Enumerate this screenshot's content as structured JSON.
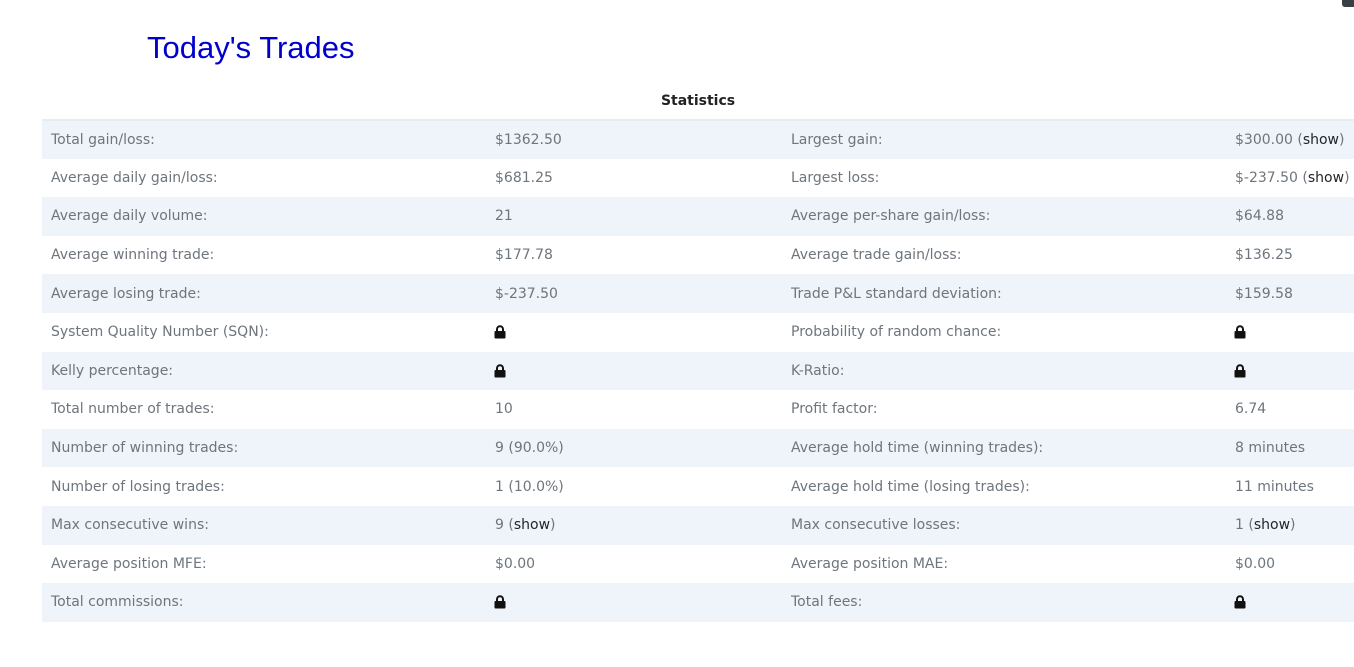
{
  "page": {
    "title": "Today's Trades"
  },
  "stats": {
    "heading": "Statistics",
    "rows": [
      {
        "left_label": "Total gain/loss:",
        "left_value": "$1362.50",
        "right_label": "Largest gain:",
        "right_value": "$300.00",
        "right_link": "show"
      },
      {
        "left_label": "Average daily gain/loss:",
        "left_value": "$681.25",
        "right_label": "Largest loss:",
        "right_value": "$-237.50",
        "right_link": "show"
      },
      {
        "left_label": "Average daily volume:",
        "left_value": "21",
        "right_label": "Average per-share gain/loss:",
        "right_value": "$64.88"
      },
      {
        "left_label": "Average winning trade:",
        "left_value": "$177.78",
        "right_label": "Average trade gain/loss:",
        "right_value": "$136.25"
      },
      {
        "left_label": "Average losing trade:",
        "left_value": "$-237.50",
        "right_label": "Trade P&L standard deviation:",
        "right_value": "$159.58"
      },
      {
        "left_label": "System Quality Number (SQN):",
        "left_locked": true,
        "right_label": "Probability of random chance:",
        "right_locked": true
      },
      {
        "left_label": "Kelly percentage:",
        "left_locked": true,
        "right_label": "K-Ratio:",
        "right_locked": true
      },
      {
        "left_label": "Total number of trades:",
        "left_value": "10",
        "right_label": "Profit factor:",
        "right_value": "6.74"
      },
      {
        "left_label": "Number of winning trades:",
        "left_value": "9 (90.0%)",
        "right_label": "Average hold time (winning trades):",
        "right_value": "8 minutes"
      },
      {
        "left_label": "Number of losing trades:",
        "left_value": "1 (10.0%)",
        "right_label": "Average hold time (losing trades):",
        "right_value": "11 minutes"
      },
      {
        "left_label": "Max consecutive wins:",
        "left_value": "9",
        "left_link": "show",
        "right_label": "Max consecutive losses:",
        "right_value": "1",
        "right_link": "show"
      },
      {
        "left_label": "Average position MFE:",
        "left_value": "$0.00",
        "right_label": "Average position MAE:",
        "right_value": "$0.00"
      },
      {
        "left_label": "Total commissions:",
        "left_locked": true,
        "right_label": "Total fees:",
        "right_locked": true
      }
    ]
  },
  "icons": {
    "lock": "lock-icon",
    "lock_color": "#111111"
  },
  "colors": {
    "title": "#0000cc",
    "row_stripe": "#eff3fa",
    "label_text": "#6e757c",
    "link_text": "#212529"
  }
}
